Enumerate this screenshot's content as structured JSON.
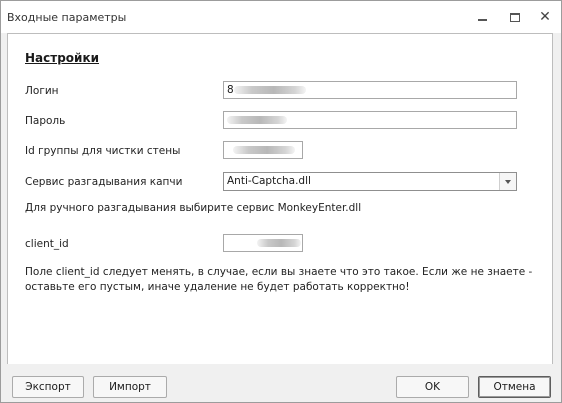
{
  "window": {
    "title": "Входные параметры"
  },
  "section": {
    "heading": "Настройки"
  },
  "fields": {
    "login": {
      "label": "Логин",
      "value_prefix": "8"
    },
    "password": {
      "label": "Пароль"
    },
    "group_id": {
      "label": "Id группы для чистки стены"
    },
    "captcha_service": {
      "label": "Сервис разгадывания капчи",
      "selected": "Anti-Captcha.dll"
    },
    "client_id": {
      "label": "client_id"
    }
  },
  "notes": {
    "manual_hint": "Для ручного разгадывания выбирите сервис MonkeyEnter.dll",
    "client_id_line1": "Поле client_id следует менять, в случае, если вы знаете что это такое. Если же не знаете -",
    "client_id_line2": "оставьте его пустым, иначе удаление не будет работать корректно!"
  },
  "buttons": {
    "export": "Экспорт",
    "import": "Импорт",
    "ok": "OK",
    "cancel": "Отмена"
  },
  "icons": {
    "minimize": "minimize-icon",
    "maximize": "maximize-icon",
    "close": "close-icon",
    "dropdown": "chevron-down-icon"
  }
}
